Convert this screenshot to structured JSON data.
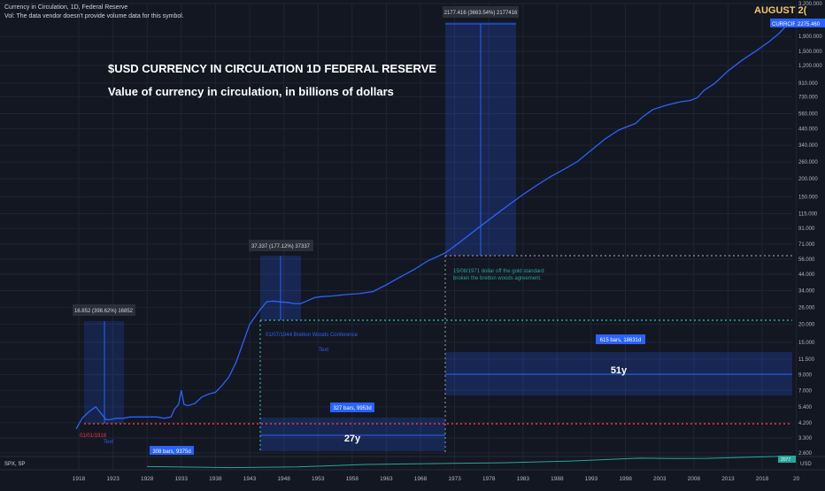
{
  "header": {
    "title": "Currency in Circulation, 1D, Federal Reserve",
    "vol_note": "Vol: The data vendor doesn't provide volume data for this symbol.",
    "corner_label": "AUGUST 2("
  },
  "annotations": {
    "headline": "$USD CURRENCY IN CIRCULATION 1D FEDERAL RESERVE",
    "subheadline": "Value of currency in circulation, in billions of dollars",
    "range1_label": "16.852 (398.62%) 16852",
    "range2_label": "37.337 (177.12%) 37337",
    "range3_label": "2177.416 (3663.54%) 2177416",
    "bretton_woods_note": "01/07/1944 Bretton Woods Conference",
    "bretton_woods_text": "Text",
    "gold_standard_note_1": "15/08/1971 dollar off the gold standard",
    "gold_standard_note_2": "broken the bretton woods agreement.",
    "date_1918": "01/01/1918",
    "date_1918_text": "Text",
    "bars_1": "308 bars, 9375d",
    "bars_2": "327 bars, 9953d",
    "bars_3": "615 bars, 18631d",
    "span_27y": "27y",
    "span_51y": "51y",
    "symbol_tag": "CURRCIR",
    "last_value": "2275.460",
    "sub_legend": "SPX, SP",
    "sub_usd": "USD",
    "sub_badge": "2077"
  },
  "chart_data": {
    "type": "line",
    "title": "Currency in Circulation, 1D, Federal Reserve",
    "xlabel": "",
    "ylabel": "",
    "y_scale": "log",
    "grid": true,
    "line_color": "#2962ff",
    "x_tick_labels": [
      "1918",
      "1923",
      "1928",
      "1933",
      "1938",
      "1943",
      "1948",
      "1953",
      "1958",
      "1963",
      "1968",
      "1973",
      "1978",
      "1983",
      "1988",
      "1993",
      "1998",
      "2003",
      "2008",
      "2013",
      "2018",
      "20"
    ],
    "y_tick_labels": [
      "3,200.000",
      "1,900.000",
      "1,500.000",
      "1,200.000",
      "910.000",
      "730.000",
      "560.000",
      "440.000",
      "340.000",
      "260.000",
      "200.000",
      "150.000",
      "115.000",
      "91.000",
      "71.000",
      "56.000",
      "44.000",
      "34.000",
      "26.000",
      "20.000",
      "15.000",
      "11.500",
      "9.000",
      "7.000",
      "5.400",
      "4.200",
      "3.300",
      "2.600"
    ],
    "series": [
      {
        "name": "CURRCIR",
        "x": [
          1917.6,
          1918.5,
          1919.5,
          1920.5,
          1921.2,
          1922,
          1922.5,
          1923.5,
          1924.5,
          1925.5,
          1926.5,
          1927.5,
          1928.5,
          1929.5,
          1930.5,
          1931.5,
          1932,
          1932.6,
          1933,
          1933.4,
          1934,
          1935,
          1936,
          1937,
          1938,
          1939,
          1940,
          1941,
          1942,
          1943,
          1944.5,
          1945.5,
          1946.5,
          1947.5,
          1948.5,
          1949.5,
          1950.5,
          1951.5,
          1952.5,
          1953.5,
          1955,
          1957,
          1959,
          1961,
          1963,
          1965,
          1967,
          1969,
          1971.6,
          1973,
          1975,
          1977,
          1979,
          1981,
          1983,
          1985,
          1987,
          1989,
          1991,
          1993,
          1995,
          1997,
          1999.5,
          2000.5,
          2002,
          2004,
          2006,
          2007.5,
          2008.5,
          2009.5,
          2011,
          2013,
          2015,
          2017,
          2019,
          2020.5,
          2021.6
        ],
        "y": [
          3.8,
          4.5,
          5.0,
          5.4,
          4.9,
          4.4,
          4.4,
          4.5,
          4.5,
          4.6,
          4.6,
          4.6,
          4.6,
          4.6,
          4.5,
          4.6,
          5.2,
          5.6,
          7.0,
          5.6,
          5.5,
          5.7,
          6.3,
          6.6,
          6.8,
          7.6,
          8.7,
          10.9,
          14.7,
          19.9,
          25.0,
          28.5,
          28.8,
          28.4,
          28.2,
          27.7,
          27.7,
          29.0,
          30.4,
          30.9,
          31.2,
          31.9,
          32.4,
          33.4,
          37.2,
          42.1,
          47.2,
          54.2,
          61.6,
          68.7,
          81.2,
          96.0,
          113.0,
          133.0,
          155.5,
          180.0,
          206.0,
          232.0,
          263.0,
          314.0,
          375.0,
          432.0,
          480.0,
          531.0,
          598.0,
          640.0,
          675.0,
          690.0,
          720.0,
          810.0,
          900.0,
          1100.0,
          1300.0,
          1500.0,
          1750.0,
          2000.0,
          2275.46
        ]
      },
      {
        "name": "SPX",
        "x": [
          1928,
          1940,
          1950,
          1960,
          1970,
          1980,
          1990,
          2000,
          2005,
          2010,
          2015,
          2020,
          2021.6
        ],
        "y": [
          20,
          12,
          17,
          58,
          92,
          135,
          330,
          1400,
          1200,
          1250,
          2050,
          3200,
          4400
        ]
      }
    ],
    "ylim": [
      2.6,
      3200
    ],
    "xlim": [
      1916.5,
      2022.6
    ]
  },
  "colors": {
    "background": "#131722",
    "grid": "#1f2433",
    "accent": "#2962ff",
    "teal": "#26a69a",
    "red_dotted": "#f23645",
    "headline_text": "#ffffff",
    "corner_label": "#f0c86c"
  }
}
